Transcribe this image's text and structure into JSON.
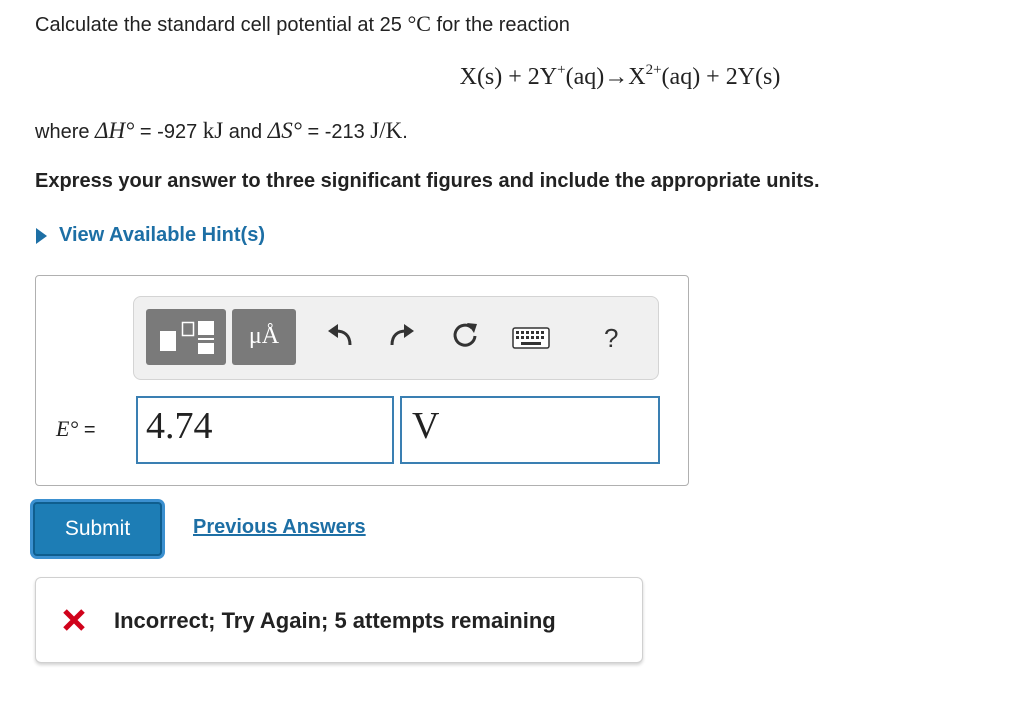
{
  "question": {
    "intro": "Calculate the standard cell potential at 25",
    "temp_unit": "°C",
    "intro_end": "for the reaction",
    "equation": {
      "part1": "X(s) + 2Y",
      "sup1": "+",
      "part2": "(aq)→X",
      "sup2": "2+",
      "part3": "(aq) + 2Y(s)"
    },
    "where_prefix": "where",
    "dH_symbol": "ΔH°",
    "dH_value": "= -927",
    "dH_unit": "kJ",
    "and": "and",
    "dS_symbol": "ΔS°",
    "dS_value": "= -213",
    "dS_unit": "J/K",
    "period": "."
  },
  "instruction": "Express your answer to three significant figures and include the appropriate units.",
  "hint_link": "View Available Hint(s)",
  "toolbar": {
    "units_button_label": "μÅ",
    "help_label": "?"
  },
  "answer": {
    "label_symbol": "E°",
    "label_equals": "=",
    "value": "4.74",
    "unit": "V"
  },
  "submit_label": "Submit",
  "previous_answers_label": "Previous Answers",
  "feedback": {
    "message": "Incorrect; Try Again; 5 attempts remaining",
    "color": "#d0021b"
  },
  "colors": {
    "link": "#1d6fa5",
    "submit_bg": "#1d7db5",
    "input_border": "#3a7fb2"
  }
}
